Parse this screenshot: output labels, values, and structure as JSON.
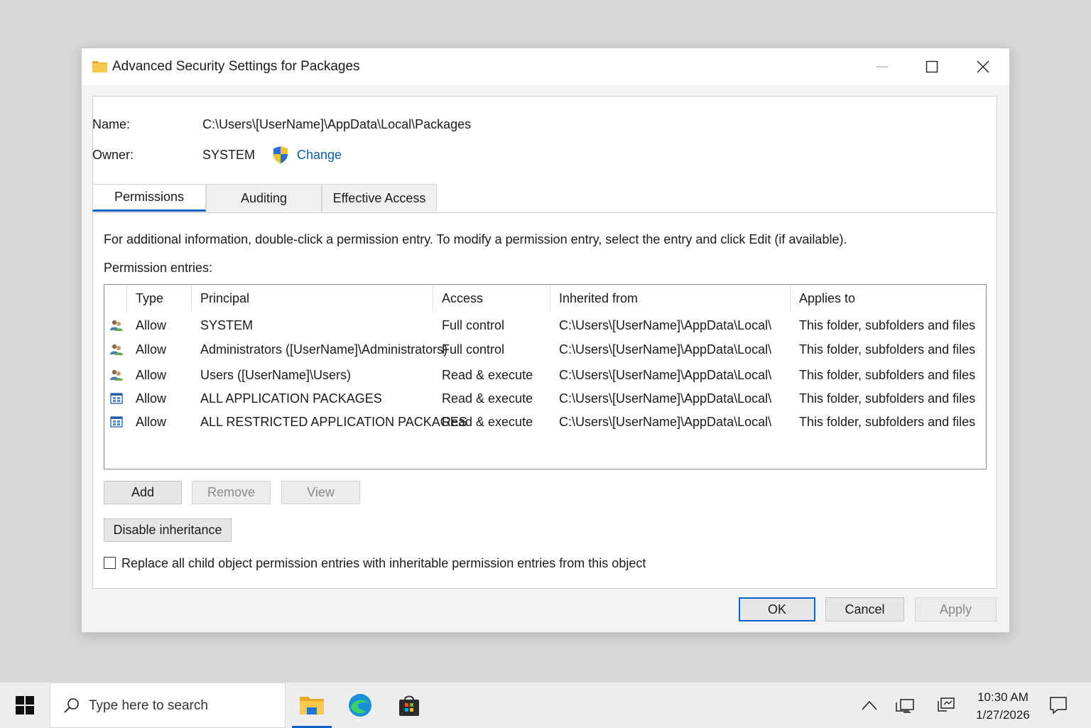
{
  "window": {
    "title": "Advanced Security Settings for Packages"
  },
  "object": {
    "name_label": "Name:",
    "name_value": "C:\\Users\\[UserName]\\AppData\\Local\\Packages",
    "owner_label": "Owner:",
    "owner_value": "SYSTEM",
    "change_link": "Change"
  },
  "tabs": [
    {
      "label": "Permissions",
      "active": true
    },
    {
      "label": "Auditing",
      "active": false
    },
    {
      "label": "Effective Access",
      "active": false
    }
  ],
  "info_text": "For additional information, double-click a permission entry. To modify a permission entry, select the entry and click Edit (if available).",
  "entries_label": "Permission entries:",
  "table": {
    "columns": [
      "Type",
      "Principal",
      "Access",
      "Inherited from",
      "Applies to"
    ],
    "rows": [
      {
        "icon": "users-icon",
        "type": "Allow",
        "principal": "SYSTEM",
        "access": "Full control",
        "inherited": "C:\\Users\\[UserName]\\AppData\\Local\\",
        "applies": "This folder, subfolders and files"
      },
      {
        "icon": "users-icon",
        "type": "Allow",
        "principal": "Administrators ([UserName]\\Administrators)",
        "access": "Full control",
        "inherited": "C:\\Users\\[UserName]\\AppData\\Local\\",
        "applies": "This folder, subfolders and files"
      },
      {
        "icon": "users-icon",
        "type": "Allow",
        "principal": "Users ([UserName]\\Users)",
        "access": "Read & execute",
        "inherited": "C:\\Users\\[UserName]\\AppData\\Local\\",
        "applies": "This folder, subfolders and files"
      },
      {
        "icon": "app-package-icon",
        "type": "Allow",
        "principal": "ALL APPLICATION PACKAGES",
        "access": "Read & execute",
        "inherited": "C:\\Users\\[UserName]\\AppData\\Local\\",
        "applies": "This folder, subfolders and files"
      },
      {
        "icon": "app-package-icon",
        "type": "Allow",
        "principal": "ALL RESTRICTED APPLICATION PACKAGES",
        "access": "Read & execute",
        "inherited": "C:\\Users\\[UserName]\\AppData\\Local\\",
        "applies": "This folder, subfolders and files"
      }
    ]
  },
  "buttons": {
    "add": "Add",
    "remove": "Remove",
    "view": "View",
    "disable_inheritance": "Disable inheritance",
    "ok": "OK",
    "cancel": "Cancel",
    "apply": "Apply"
  },
  "replace_checkbox": {
    "label": "Replace all child object permission entries with inheritable permission entries from this object",
    "checked": false
  },
  "taskbar": {
    "search_placeholder": "Type here to search",
    "time": "10:30 AM",
    "date": "1/27/2026"
  },
  "colors": {
    "accent": "#0a64c8",
    "link": "#0a5fb0",
    "folder": "#f5c242"
  }
}
